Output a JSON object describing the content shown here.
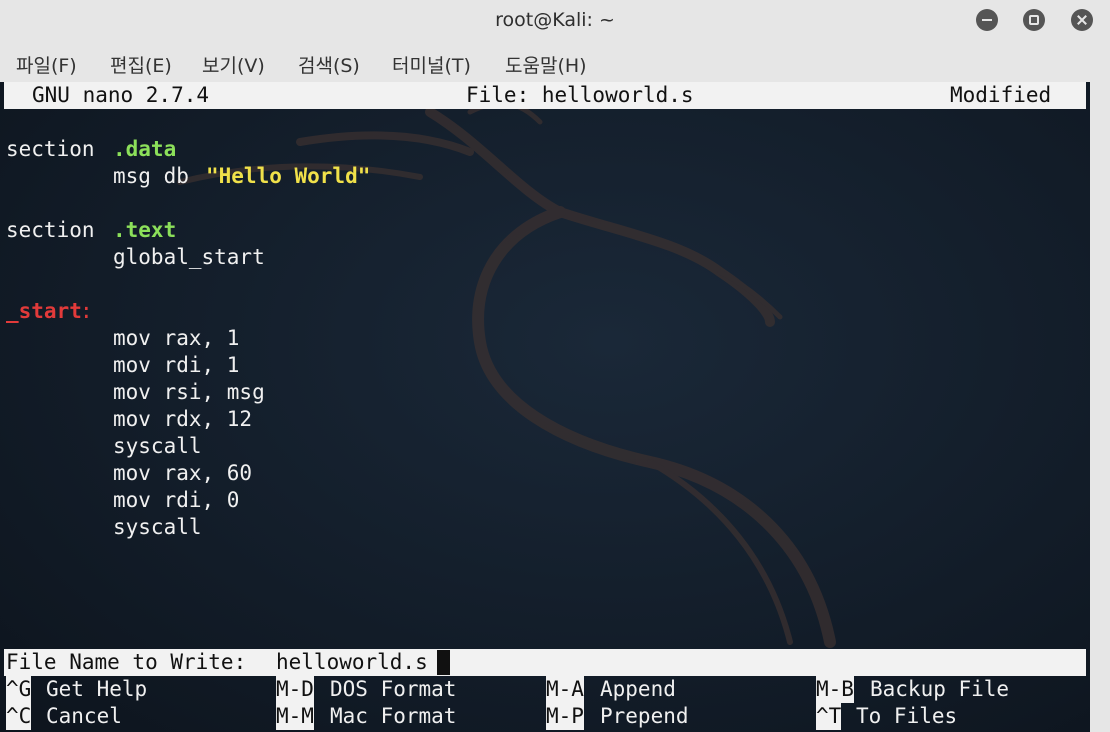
{
  "window": {
    "title": "root@Kali: ~"
  },
  "menu": [
    "파일(F)",
    "편집(E)",
    "보기(V)",
    "검색(S)",
    "터미널(T)",
    "도움말(H)"
  ],
  "nano": {
    "version": "GNU nano 2.7.4",
    "file_label": "File: helloworld.s",
    "status": "Modified"
  },
  "code": {
    "l1_kw": "section",
    "l1_dir": ".data",
    "l2_pre": "msg db ",
    "l2_str": "\"Hello World\"",
    "l4_kw": "section",
    "l4_dir": ".text",
    "l5": "global_start",
    "l7_label": "_start",
    "l7_colon": ":",
    "l8": "mov rax, 1",
    "l9": "mov rdi, 1",
    "l10": "mov rsi, msg",
    "l11": "mov rdx, 12",
    "l12": "syscall",
    "l13": "mov rax, 60",
    "l14": "mov rdi, 0",
    "l15": "syscall"
  },
  "prompt": {
    "label": "File Name to Write: ",
    "value": "helloworld.s"
  },
  "shortcuts": [
    {
      "key": "^G",
      "label": "Get Help"
    },
    {
      "key": "M-D",
      "label": "DOS Format"
    },
    {
      "key": "M-A",
      "label": "Append"
    },
    {
      "key": "M-B",
      "label": "Backup File"
    },
    {
      "key": "^C",
      "label": "Cancel"
    },
    {
      "key": "M-M",
      "label": "Mac Format"
    },
    {
      "key": "M-P",
      "label": "Prepend"
    },
    {
      "key": "^T",
      "label": "To Files"
    }
  ],
  "colors": {
    "terminal_bg": "#0f1822",
    "keyword_green": "#8ce05a",
    "string_yellow": "#f0e14a",
    "label_red": "#e23a3a"
  }
}
